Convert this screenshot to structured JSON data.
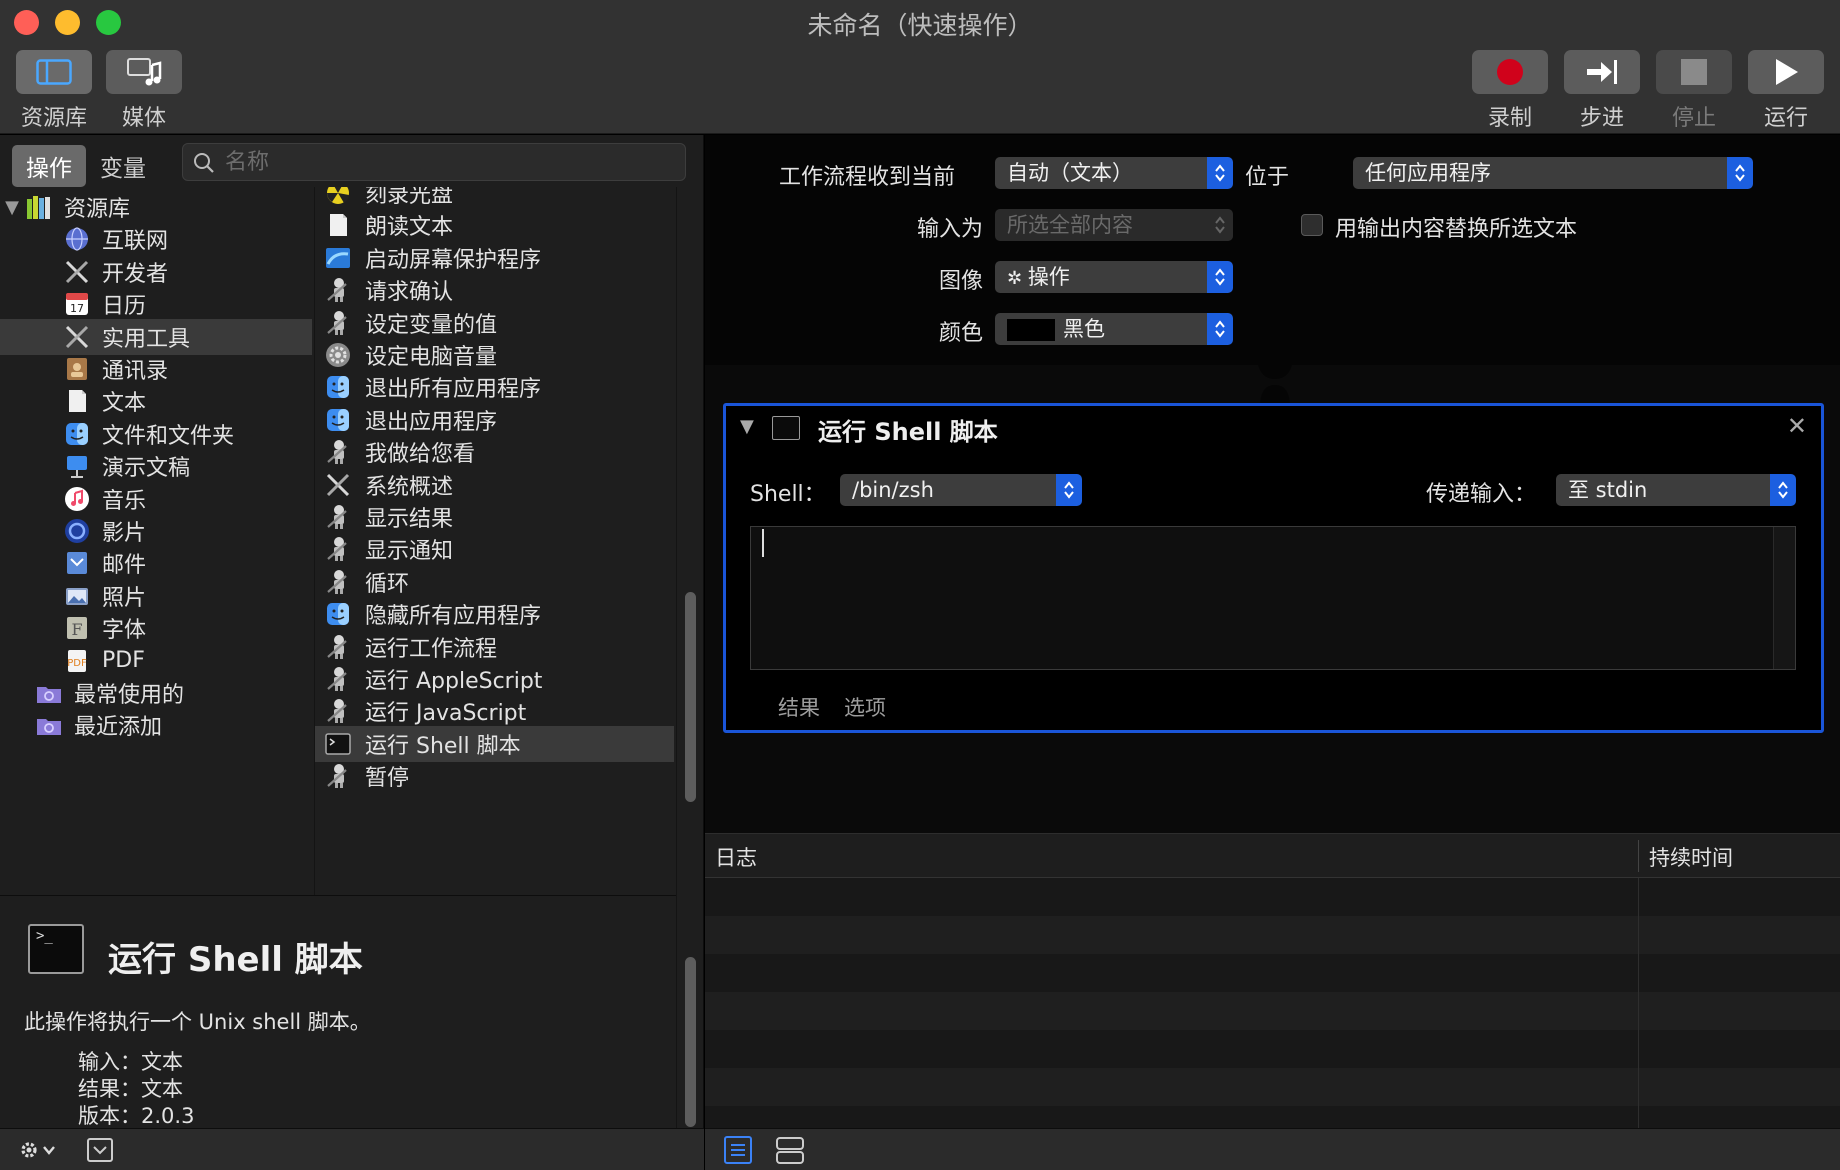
{
  "window": {
    "title": "未命名（快速操作）"
  },
  "toolbar": {
    "library_label": "资源库",
    "media_label": "媒体",
    "record_label": "录制",
    "step_label": "步进",
    "stop_label": "停止",
    "run_label": "运行"
  },
  "left": {
    "tab_actions": "操作",
    "tab_variables": "变量",
    "search_placeholder": "名称",
    "library_items": [
      {
        "label": "资源库",
        "icon": "library-icon",
        "color": "#c8d832"
      },
      {
        "label": "互联网",
        "icon": "globe-icon",
        "color": "#6a7fd8"
      },
      {
        "label": "开发者",
        "icon": "tools-icon",
        "color": "#cfcfcf"
      },
      {
        "label": "日历",
        "icon": "calendar-icon",
        "color": "#e04848"
      },
      {
        "label": "实用工具",
        "icon": "tools-icon",
        "color": "#cfcfcf"
      },
      {
        "label": "通讯录",
        "icon": "contacts-icon",
        "color": "#b08050"
      },
      {
        "label": "文本",
        "icon": "text-icon",
        "color": "#f0f0f0"
      },
      {
        "label": "文件和文件夹",
        "icon": "finder-icon",
        "color": "#3d8df0"
      },
      {
        "label": "演示文稿",
        "icon": "keynote-icon",
        "color": "#3d8df0"
      },
      {
        "label": "音乐",
        "icon": "music-icon",
        "color": "#f04a6a"
      },
      {
        "label": "影片",
        "icon": "movie-icon",
        "color": "#3060d0"
      },
      {
        "label": "邮件",
        "icon": "mail-icon",
        "color": "#5a8ad8"
      },
      {
        "label": "照片",
        "icon": "photo-icon",
        "color": "#8aa0c8"
      },
      {
        "label": "字体",
        "icon": "font-icon",
        "color": "#c0c0b0"
      },
      {
        "label": "PDF",
        "icon": "pdf-icon",
        "color": "#e0a040"
      },
      {
        "label": "最常使用的",
        "icon": "smart-folder-icon",
        "color": "#8a7ad8"
      },
      {
        "label": "最近添加",
        "icon": "smart-folder-icon",
        "color": "#8a7ad8"
      }
    ],
    "action_items": [
      {
        "label": "刻录光盘",
        "icon": "burn-icon"
      },
      {
        "label": "朗读文本",
        "icon": "text-icon"
      },
      {
        "label": "启动屏幕保护程序",
        "icon": "screensaver-icon"
      },
      {
        "label": "请求确认",
        "icon": "automator-robot-icon"
      },
      {
        "label": "设定变量的值",
        "icon": "automator-robot-icon"
      },
      {
        "label": "设定电脑音量",
        "icon": "system-prefs-icon"
      },
      {
        "label": "退出所有应用程序",
        "icon": "finder-icon"
      },
      {
        "label": "退出应用程序",
        "icon": "finder-icon"
      },
      {
        "label": "我做给您看",
        "icon": "automator-robot-icon"
      },
      {
        "label": "系统概述",
        "icon": "tools-icon"
      },
      {
        "label": "显示结果",
        "icon": "automator-robot-icon"
      },
      {
        "label": "显示通知",
        "icon": "automator-robot-icon"
      },
      {
        "label": "循环",
        "icon": "automator-robot-icon"
      },
      {
        "label": "隐藏所有应用程序",
        "icon": "finder-icon"
      },
      {
        "label": "运行工作流程",
        "icon": "automator-robot-icon"
      },
      {
        "label": "运行 AppleScript",
        "icon": "automator-robot-icon"
      },
      {
        "label": "运行 JavaScript",
        "icon": "automator-robot-icon"
      },
      {
        "label": "运行 Shell 脚本",
        "icon": "terminal-icon"
      },
      {
        "label": "暂停",
        "icon": "automator-robot-icon"
      }
    ],
    "selected_library": "实用工具",
    "selected_action": "运行 Shell 脚本",
    "description": {
      "title": "运行 Shell 脚本",
      "text": "此操作将执行一个 Unix shell 脚本。",
      "input_label": "输入：",
      "input_value": "文本",
      "result_label": "结果：",
      "result_value": "文本",
      "version_label": "版本：",
      "version_value": "2.0.3"
    }
  },
  "workflow": {
    "receives_label": "工作流程收到当前",
    "receives_value": "自动（文本）",
    "in_label": "位于",
    "in_value": "任何应用程序",
    "input_is_label": "输入为",
    "input_is_value": "所选全部内容",
    "replace_label": "用输出内容替换所选文本",
    "image_label": "图像",
    "image_value": "操作",
    "color_label": "颜色",
    "color_value": "黑色"
  },
  "action_card": {
    "title": "运行 Shell 脚本",
    "shell_label": "Shell：",
    "shell_value": "/bin/zsh",
    "pass_input_label": "传递输入：",
    "pass_input_value": "至 stdin",
    "script": "",
    "tab_results": "结果",
    "tab_options": "选项"
  },
  "log": {
    "col_log": "日志",
    "col_duration": "持续时间"
  },
  "colors": {
    "accent": "#1a55d8",
    "record": "#d0021b"
  }
}
